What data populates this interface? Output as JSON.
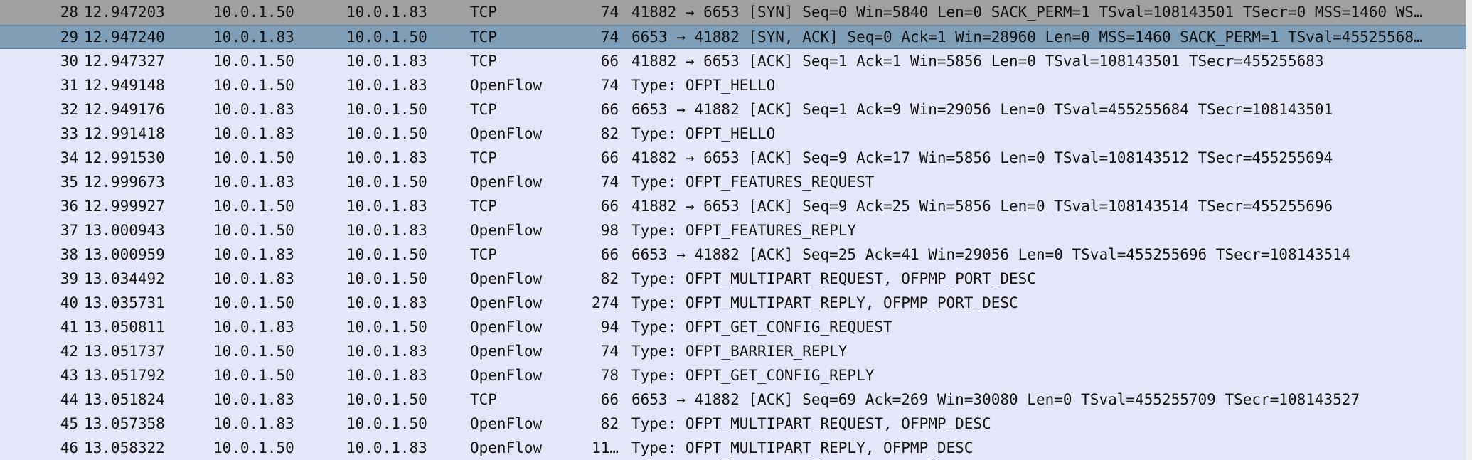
{
  "packets": [
    {
      "no": "28",
      "time": "12.947203",
      "src": "10.0.1.50",
      "dst": "10.0.1.83",
      "proto": "TCP",
      "len": "74",
      "info": "41882 → 6653 [SYN] Seq=0 Win=5840 Len=0 SACK_PERM=1 TSval=108143501 TSecr=0 MSS=1460 WS…"
    },
    {
      "no": "29",
      "time": "12.947240",
      "src": "10.0.1.83",
      "dst": "10.0.1.50",
      "proto": "TCP",
      "len": "74",
      "info": "6653 → 41882 [SYN, ACK] Seq=0 Ack=1 Win=28960 Len=0 MSS=1460 SACK_PERM=1 TSval=45525568…"
    },
    {
      "no": "30",
      "time": "12.947327",
      "src": "10.0.1.50",
      "dst": "10.0.1.83",
      "proto": "TCP",
      "len": "66",
      "info": "41882 → 6653 [ACK] Seq=1 Ack=1 Win=5856 Len=0 TSval=108143501 TSecr=455255683"
    },
    {
      "no": "31",
      "time": "12.949148",
      "src": "10.0.1.50",
      "dst": "10.0.1.83",
      "proto": "OpenFlow",
      "len": "74",
      "info": "Type: OFPT_HELLO"
    },
    {
      "no": "32",
      "time": "12.949176",
      "src": "10.0.1.83",
      "dst": "10.0.1.50",
      "proto": "TCP",
      "len": "66",
      "info": "6653 → 41882 [ACK] Seq=1 Ack=9 Win=29056 Len=0 TSval=455255684 TSecr=108143501"
    },
    {
      "no": "33",
      "time": "12.991418",
      "src": "10.0.1.83",
      "dst": "10.0.1.50",
      "proto": "OpenFlow",
      "len": "82",
      "info": "Type: OFPT_HELLO"
    },
    {
      "no": "34",
      "time": "12.991530",
      "src": "10.0.1.50",
      "dst": "10.0.1.83",
      "proto": "TCP",
      "len": "66",
      "info": "41882 → 6653 [ACK] Seq=9 Ack=17 Win=5856 Len=0 TSval=108143512 TSecr=455255694"
    },
    {
      "no": "35",
      "time": "12.999673",
      "src": "10.0.1.83",
      "dst": "10.0.1.50",
      "proto": "OpenFlow",
      "len": "74",
      "info": "Type: OFPT_FEATURES_REQUEST"
    },
    {
      "no": "36",
      "time": "12.999927",
      "src": "10.0.1.50",
      "dst": "10.0.1.83",
      "proto": "TCP",
      "len": "66",
      "info": "41882 → 6653 [ACK] Seq=9 Ack=25 Win=5856 Len=0 TSval=108143514 TSecr=455255696"
    },
    {
      "no": "37",
      "time": "13.000943",
      "src": "10.0.1.50",
      "dst": "10.0.1.83",
      "proto": "OpenFlow",
      "len": "98",
      "info": "Type: OFPT_FEATURES_REPLY"
    },
    {
      "no": "38",
      "time": "13.000959",
      "src": "10.0.1.83",
      "dst": "10.0.1.50",
      "proto": "TCP",
      "len": "66",
      "info": "6653 → 41882 [ACK] Seq=25 Ack=41 Win=29056 Len=0 TSval=455255696 TSecr=108143514"
    },
    {
      "no": "39",
      "time": "13.034492",
      "src": "10.0.1.83",
      "dst": "10.0.1.50",
      "proto": "OpenFlow",
      "len": "82",
      "info": "Type: OFPT_MULTIPART_REQUEST, OFPMP_PORT_DESC"
    },
    {
      "no": "40",
      "time": "13.035731",
      "src": "10.0.1.50",
      "dst": "10.0.1.83",
      "proto": "OpenFlow",
      "len": "274",
      "info": "Type: OFPT_MULTIPART_REPLY, OFPMP_PORT_DESC"
    },
    {
      "no": "41",
      "time": "13.050811",
      "src": "10.0.1.83",
      "dst": "10.0.1.50",
      "proto": "OpenFlow",
      "len": "94",
      "info": "Type: OFPT_GET_CONFIG_REQUEST"
    },
    {
      "no": "42",
      "time": "13.051737",
      "src": "10.0.1.50",
      "dst": "10.0.1.83",
      "proto": "OpenFlow",
      "len": "74",
      "info": "Type: OFPT_BARRIER_REPLY"
    },
    {
      "no": "43",
      "time": "13.051792",
      "src": "10.0.1.50",
      "dst": "10.0.1.83",
      "proto": "OpenFlow",
      "len": "78",
      "info": "Type: OFPT_GET_CONFIG_REPLY"
    },
    {
      "no": "44",
      "time": "13.051824",
      "src": "10.0.1.83",
      "dst": "10.0.1.50",
      "proto": "TCP",
      "len": "66",
      "info": "6653 → 41882 [ACK] Seq=69 Ack=269 Win=30080 Len=0 TSval=455255709 TSecr=108143527"
    },
    {
      "no": "45",
      "time": "13.057358",
      "src": "10.0.1.83",
      "dst": "10.0.1.50",
      "proto": "OpenFlow",
      "len": "82",
      "info": "Type: OFPT_MULTIPART_REQUEST, OFPMP_DESC"
    },
    {
      "no": "46",
      "time": "13.058322",
      "src": "10.0.1.50",
      "dst": "10.0.1.83",
      "proto": "OpenFlow",
      "len": "11…",
      "info": "Type: OFPT_MULTIPART_REPLY, OFPMP_DESC"
    }
  ],
  "selected_no": "29",
  "colors": {
    "row_background": "#e6e6fa",
    "selected_background": "#7f9fb9",
    "first_row_background": "#a0a0a0"
  }
}
